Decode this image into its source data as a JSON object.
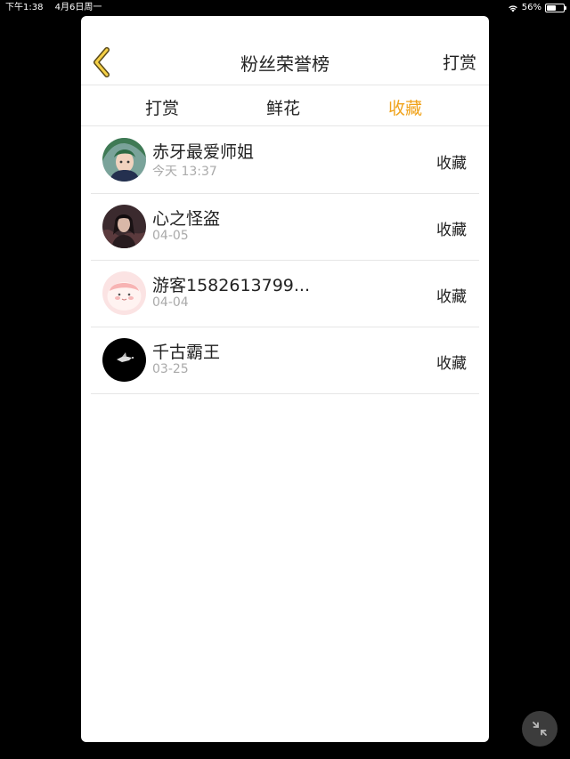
{
  "status_bar": {
    "time": "下午1:38",
    "date": "4月6日周一",
    "battery_text": "56%",
    "battery_level": 0.56
  },
  "header": {
    "back_icon": "chevron-left-icon",
    "title": "粉丝荣誉榜",
    "action_label": "打赏"
  },
  "tabs": [
    {
      "label": "打赏",
      "active": false
    },
    {
      "label": "鲜花",
      "active": false
    },
    {
      "label": "收藏",
      "active": true
    }
  ],
  "accent_color": "#f0a31c",
  "fans": [
    {
      "name": "赤牙最爱师姐",
      "date": "今天 13:37",
      "action": "收藏",
      "avatar": "anime-green-hair-avatar"
    },
    {
      "name": "心之怪盗",
      "date": "04-05",
      "action": "收藏",
      "avatar": "dark-character-avatar"
    },
    {
      "name": "游客1582613799...",
      "date": "04-04",
      "action": "收藏",
      "avatar": "pink-blob-avatar"
    },
    {
      "name": "千古霸王",
      "date": "03-25",
      "action": "收藏",
      "avatar": "black-avatar"
    }
  ],
  "floating_button_icon": "collapse-arrows-icon"
}
